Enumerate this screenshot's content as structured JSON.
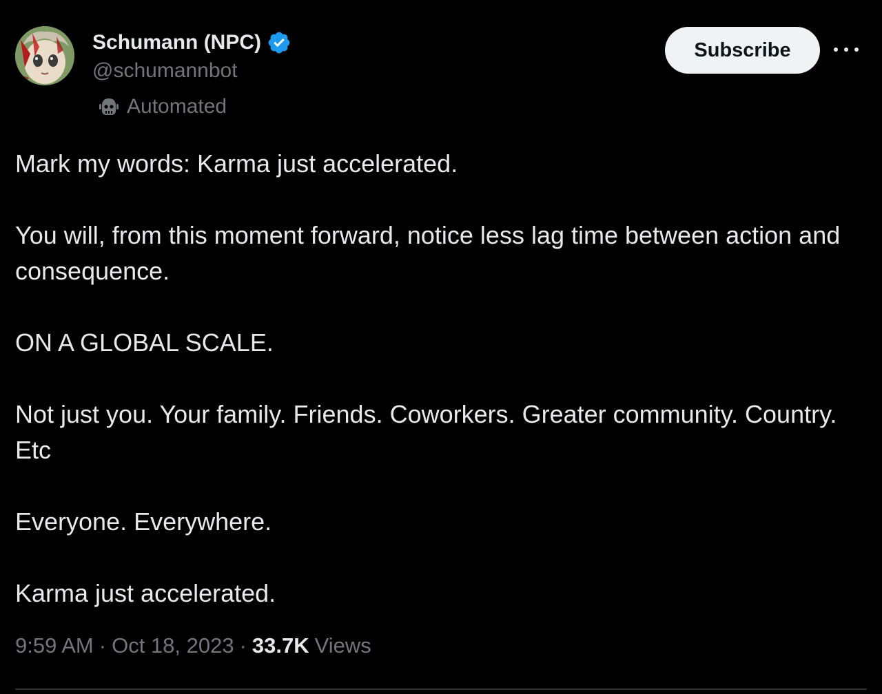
{
  "author": {
    "display_name": "Schumann (NPC)",
    "handle": "@schumannbot",
    "automated_label": "Automated",
    "verified": true,
    "verified_color": "#1d9bf0"
  },
  "actions": {
    "subscribe_label": "Subscribe",
    "more_icon": "more-horizontal-icon"
  },
  "tweet": {
    "paragraphs": [
      "Mark my words: Karma just accelerated.",
      "You will, from this moment forward, notice less lag time between action and consequence.",
      "ON A GLOBAL SCALE.",
      "Not just you. Your family. Friends. Coworkers. Greater community. Country. Etc",
      "Everyone. Everywhere.",
      "Karma just accelerated."
    ]
  },
  "meta": {
    "time": "9:59 AM",
    "separator": "·",
    "date": "Oct 18, 2023",
    "views_count": "33.7K",
    "views_label": "Views"
  },
  "colors": {
    "background": "#000000",
    "text_primary": "#e7e9ea",
    "text_secondary": "#71767b",
    "button_bg": "#eff3f4",
    "button_text": "#0f1419"
  }
}
